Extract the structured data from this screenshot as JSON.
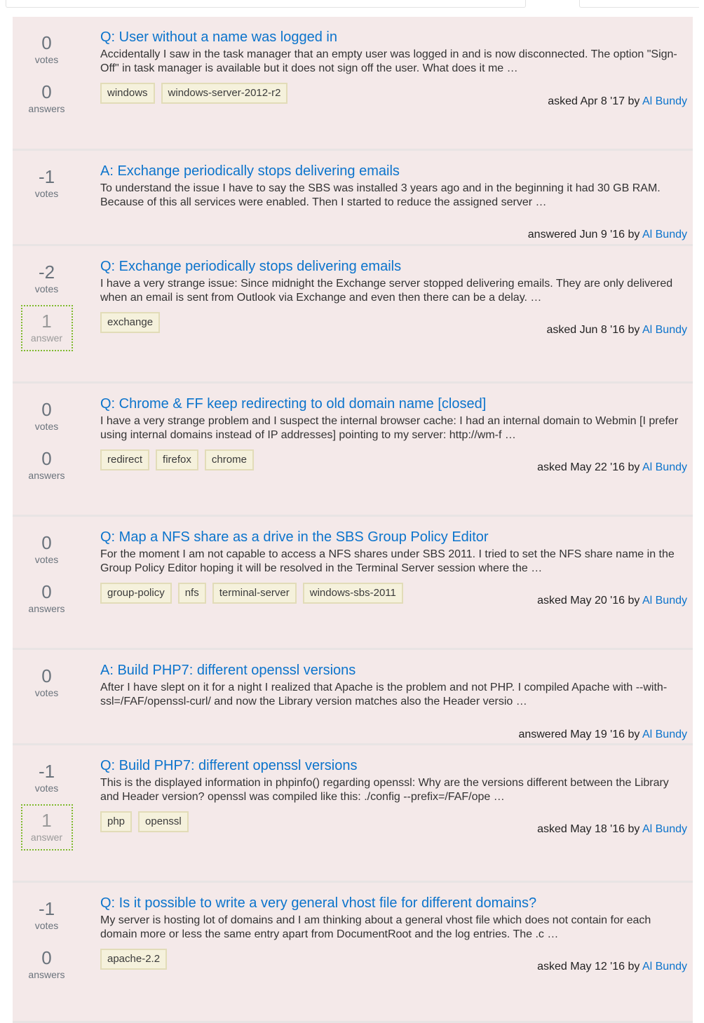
{
  "labels": {
    "votes": "votes",
    "answers": "answers",
    "answer": "answer",
    "by": "by"
  },
  "items": [
    {
      "votes": "0",
      "answers": "0",
      "answers_label": "answers",
      "accepted": false,
      "title": "Q: User without a name was logged in",
      "excerpt": "Accidentally I saw in the task manager that an empty user was logged in and is now disconnected. The option \"Sign-Off\" in task manager is available but it does not sign off the user. What does it me …",
      "tags": [
        "windows",
        "windows-server-2012-r2"
      ],
      "action": "asked Apr 8 '17",
      "user": "Al Bundy"
    },
    {
      "votes": "-1",
      "answers": null,
      "accepted": false,
      "title": "A: Exchange periodically stops delivering emails",
      "excerpt": "To understand the issue I have to say the SBS was installed 3 years ago and in the beginning it had 30 GB RAM. Because of this all services were enabled. Then I started to reduce the assigned server …",
      "tags": [],
      "action": "answered Jun 9 '16",
      "user": "Al Bundy"
    },
    {
      "votes": "-2",
      "answers": "1",
      "answers_label": "answer",
      "accepted": true,
      "title": "Q: Exchange periodically stops delivering emails",
      "excerpt": "I have a very strange issue: Since midnight the Exchange server stopped delivering emails. They are only delivered when an email is sent from Outlook via Exchange and even then there can be a delay. …",
      "tags": [
        "exchange"
      ],
      "action": "asked Jun 8 '16",
      "user": "Al Bundy"
    },
    {
      "votes": "0",
      "answers": "0",
      "answers_label": "answers",
      "accepted": false,
      "title": "Q: Chrome & FF keep redirecting to old domain name [closed]",
      "excerpt": "I have a very strange problem and I suspect the internal browser cache: I had an internal domain to Webmin [I prefer using internal domains instead of IP addresses] pointing to my server: http://wm-f …",
      "tags": [
        "redirect",
        "firefox",
        "chrome"
      ],
      "action": "asked May 22 '16",
      "user": "Al Bundy"
    },
    {
      "votes": "0",
      "answers": "0",
      "answers_label": "answers",
      "accepted": false,
      "title": "Q: Map a NFS share as a drive in the SBS Group Policy Editor",
      "excerpt": "For the moment I am not capable to access a NFS shares under SBS 2011. I tried to set the NFS share name in the Group Policy Editor hoping it will be resolved in the Terminal Server session where the …",
      "tags": [
        "group-policy",
        "nfs",
        "terminal-server",
        "windows-sbs-2011"
      ],
      "action": "asked May 20 '16",
      "user": "Al Bundy"
    },
    {
      "votes": "0",
      "answers": null,
      "accepted": false,
      "title": "A: Build PHP7: different openssl versions",
      "excerpt": "After I have slept on it for a night I realized that Apache is the problem and not PHP. I compiled Apache with --with-ssl=/FAF/openssl-curl/ and now the Library version matches also the Header versio …",
      "tags": [],
      "action": "answered May 19 '16",
      "user": "Al Bundy"
    },
    {
      "votes": "-1",
      "answers": "1",
      "answers_label": "answer",
      "accepted": true,
      "title": "Q: Build PHP7: different openssl versions",
      "excerpt": "This is the displayed information in phpinfo() regarding openssl: Why are the versions different between the Library and Header version? openssl was compiled like this: ./config --prefix=/FAF/ope …",
      "tags": [
        "php",
        "openssl"
      ],
      "action": "asked May 18 '16",
      "user": "Al Bundy"
    },
    {
      "votes": "-1",
      "answers": "0",
      "answers_label": "answers",
      "accepted": false,
      "title": "Q: Is it possible to write a very general vhost file for different domains?",
      "excerpt": "My server is hosting lot of domains and I am thinking about a general vhost file which does not contain for each domain more or less the same entry apart from DocumentRoot and the log entries. The .c …",
      "tags": [
        "apache-2.2"
      ],
      "action": "asked May 12 '16",
      "user": "Al Bundy"
    }
  ]
}
